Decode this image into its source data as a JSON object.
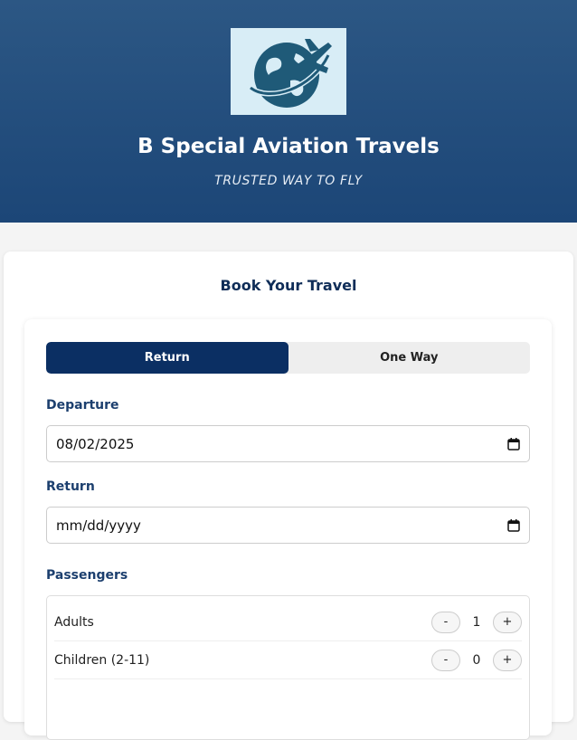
{
  "header": {
    "brand": "B Special Aviation Travels",
    "tagline": "TRUSTED WAY TO FLY",
    "logo_icon": "globe-airplane-logo"
  },
  "booking": {
    "title": "Book Your Travel",
    "trip_types": [
      {
        "label": "Return",
        "active": true
      },
      {
        "label": "One Way",
        "active": false
      }
    ],
    "departure_label": "Departure",
    "departure_value": "08/02/2025",
    "return_label": "Return",
    "return_value": "mm/dd/yyyy",
    "passengers_label": "Passengers",
    "passengers": [
      {
        "name": "Adults",
        "count": "1"
      },
      {
        "name": "Children (2-11)",
        "count": "0"
      }
    ],
    "decrement_label": "-",
    "increment_label": "+"
  },
  "colors": {
    "header_top": "#2c5784",
    "header_bottom": "#1c4677",
    "primary": "#0b2f63",
    "label": "#1c3f6e"
  }
}
